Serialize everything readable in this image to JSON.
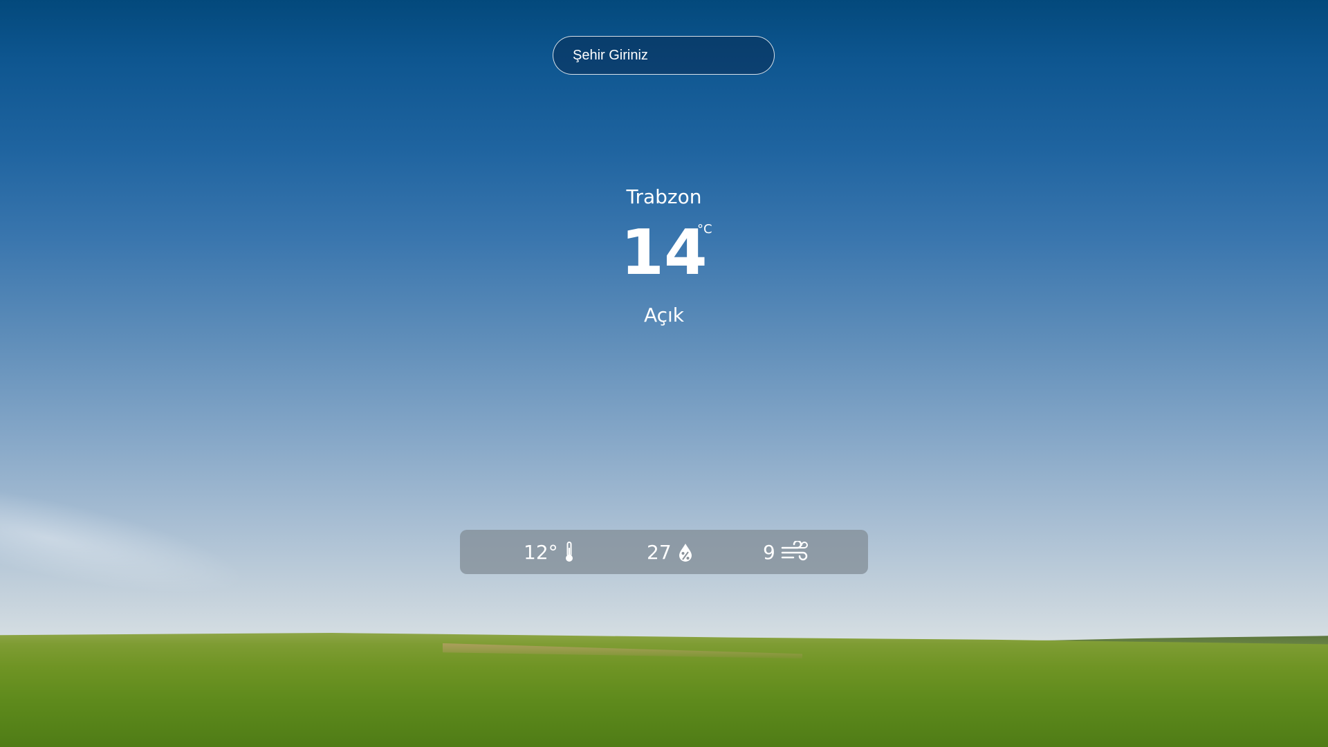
{
  "search": {
    "placeholder": "Şehir Giriniz"
  },
  "weather": {
    "city": "Trabzon",
    "temperature": "14",
    "unit": "°C",
    "condition": "Açık"
  },
  "stats": {
    "feels_like": "12°",
    "humidity": "27",
    "wind": "9"
  }
}
